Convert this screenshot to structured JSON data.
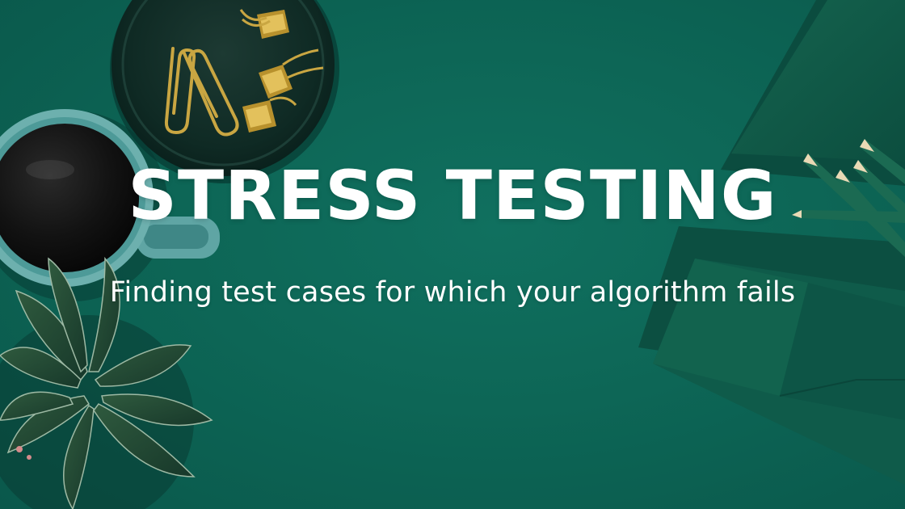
{
  "banner": {
    "title": "STRESS TESTING",
    "subtitle": "Finding test cases for which your algorithm fails"
  },
  "colors": {
    "background": "#0d6656",
    "text": "#ffffff",
    "brass": "#c9a642"
  },
  "icons": [
    "coffee-mug-icon",
    "paper-clip-icon",
    "binder-clip-icon",
    "plant-icon",
    "pencil-icon",
    "notebook-icon",
    "envelope-icon"
  ]
}
